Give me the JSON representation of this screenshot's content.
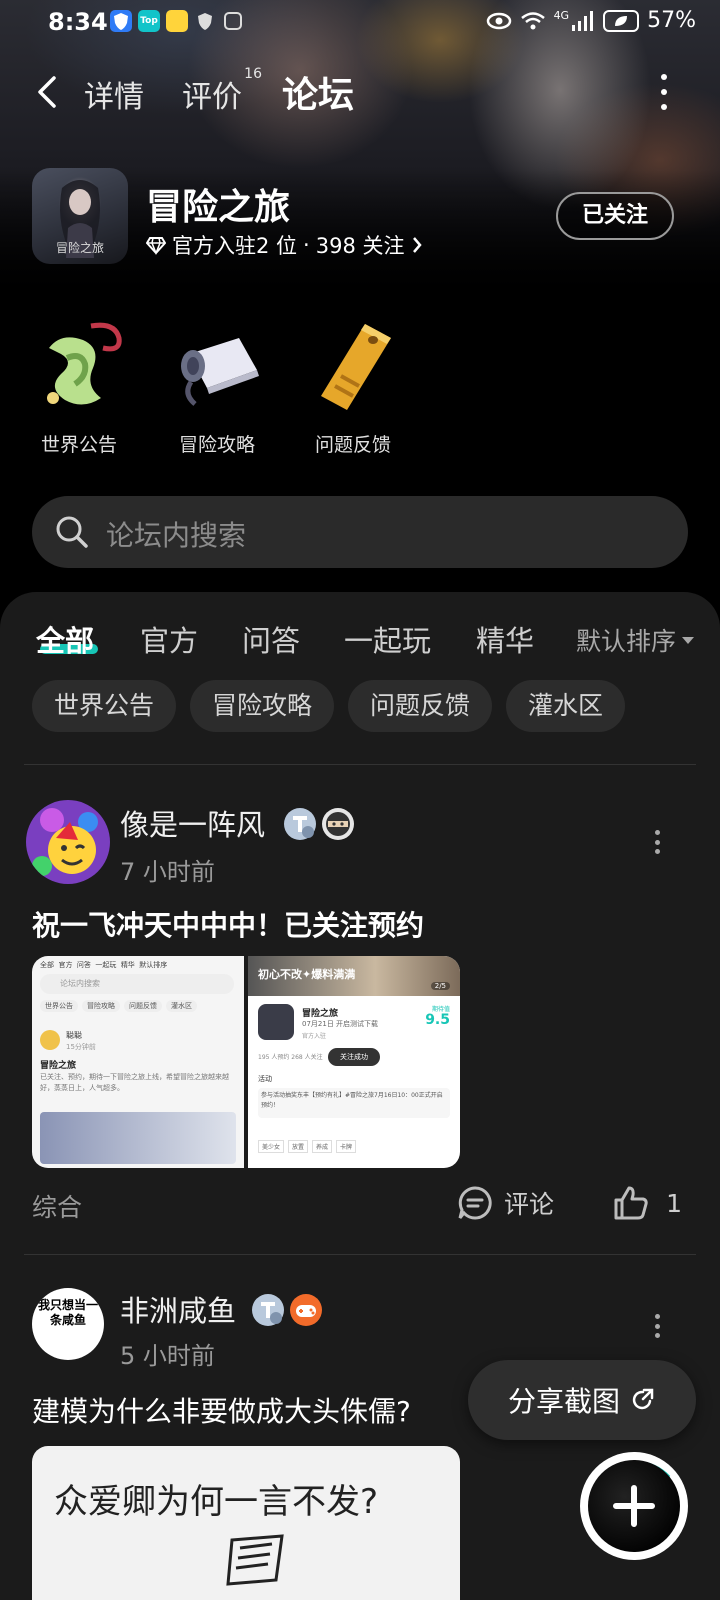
{
  "status_bar": {
    "time": "8:34",
    "network": "4G",
    "battery_percent": "57%",
    "app_icons": [
      "shield-app-icon",
      "top-app-icon",
      "sticker-app-icon",
      "vpn-icon",
      "gallery-icon"
    ]
  },
  "nav": {
    "tabs": [
      {
        "label": "详情"
      },
      {
        "label": "评价",
        "count": "16"
      },
      {
        "label": "论坛"
      }
    ],
    "active_tab": "论坛",
    "accent_color": "#17c6b6"
  },
  "game": {
    "name": "冒险之旅",
    "icon_caption": "冒险之旅",
    "official_count": "官方入驻2 位",
    "separator": "·",
    "followers": "398 关注",
    "follow_state": "已关注"
  },
  "categories": [
    {
      "label": "世界公告",
      "icon": "scroll-ribbon-icon"
    },
    {
      "label": "冒险攻略",
      "icon": "paper-scroll-icon"
    },
    {
      "label": "问题反馈",
      "icon": "golden-ticket-icon"
    }
  ],
  "search": {
    "placeholder": "论坛内搜索"
  },
  "feed": {
    "tabs": [
      "全部",
      "官方",
      "问答",
      "一起玩",
      "精华"
    ],
    "active_tab": "全部",
    "sort": "默认排序",
    "chips": [
      "世界公告",
      "冒险攻略",
      "问题反馈",
      "灌水区"
    ]
  },
  "posts": [
    {
      "username": "像是一阵风",
      "time": "7 小时前",
      "title": "祝一飞冲天中中中！已关注预约",
      "category": "综合",
      "comment_label": "评论",
      "likes": "1",
      "thumb_left": {
        "tabs": [
          "全部",
          "官方",
          "问答",
          "一起玩",
          "精华",
          "默认排序"
        ],
        "search": "论坛内搜索",
        "chips": [
          "世界公告",
          "冒险攻略",
          "问题反馈",
          "灌水区"
        ],
        "user": "聪聪",
        "time": "15分钟前",
        "title": "冒险之旅",
        "body": "已关注、预约，期待一下冒险之旅上线，希望冒险之旅越来越好，蒸蒸日上，人气超多。"
      },
      "thumb_right": {
        "banner": "初心不改✦爆料满满",
        "page": "2/5",
        "game": "冒险之旅",
        "date": "07月21日 开启测试下载",
        "score_label": "期待值",
        "score": "9.5",
        "official": "官方入驻",
        "stats": "195 人预约   268 人关注",
        "follow_success": "关注成功",
        "activity": "活动",
        "promo": "参与活动抽奖东丰【预约有礼】#冒险之旅7月16日10：00正式开启预约！",
        "tags": [
          "美少女",
          "放置",
          "养成",
          "卡牌"
        ]
      }
    },
    {
      "username": "非洲咸鱼",
      "avatar_text": "我只想当一条咸鱼",
      "time": "5 小时前",
      "title": "建模为什么非要做成大头侏儒?",
      "image_text": "众爱卿为何一言不发?"
    }
  ],
  "floating": {
    "share_label": "分享截图",
    "fab": "plus-icon"
  }
}
